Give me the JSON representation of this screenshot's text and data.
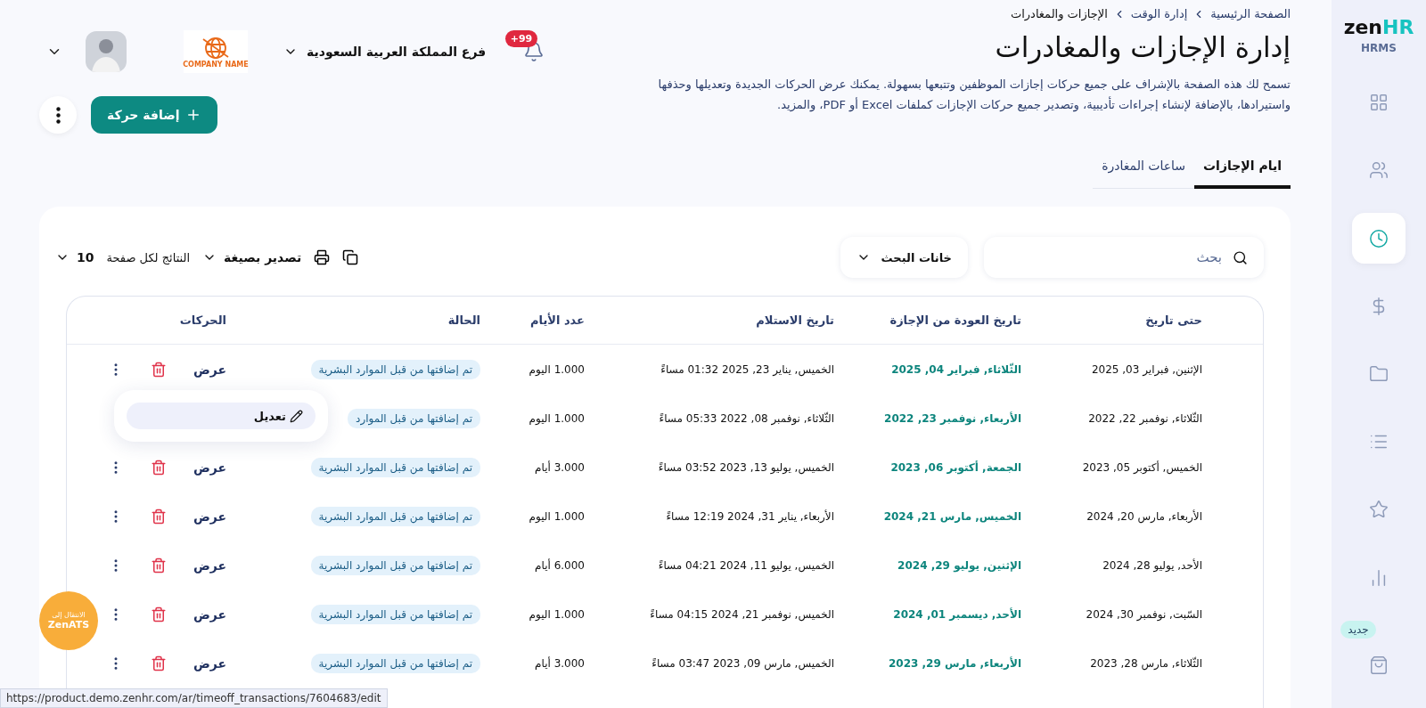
{
  "sidebar": {
    "logo_word": "zen",
    "logo_accent": "HR",
    "subtitle": "HRMS",
    "items": [
      {
        "selected": false
      },
      {
        "selected": false
      },
      {
        "selected": true
      },
      {
        "selected": false
      },
      {
        "selected": false
      },
      {
        "selected": false
      },
      {
        "selected": false
      },
      {
        "selected": false
      },
      {
        "selected": false
      }
    ],
    "new_badge": "جديد"
  },
  "breadcrumbs": [
    "الصفحة الرئيسية",
    "إدارة الوقت",
    "الإجازات والمغادرات"
  ],
  "title": "إدارة الإجازات والمغادرات",
  "description": "تسمح لك هذه الصفحة بالإشراف على جميع حركات إجازات الموظفين وتتبعها بسهولة. يمكنك عرض الحركات الجديدة وتعديلها وحذفها واستيرادها، بالإضافة لإنشاء إجراءات تأديبية، وتصدير جميع حركات الإجازات كملفات Excel أو PDF، والمزيد.",
  "topbar": {
    "notifications_badge": "+99",
    "branch": "فرع المملكة العربية السعودية",
    "company_logo_text": "COMPANY NAME"
  },
  "add_button": "إضافة حركة",
  "tabs": [
    {
      "label": "ايام الإجازات",
      "selected": true
    },
    {
      "label": "ساعات المغادرة",
      "selected": false
    }
  ],
  "search": {
    "placeholder": "بحث"
  },
  "search_fields_button": "خانات البحث",
  "export_label": "تصدير بصيغة",
  "per_page": {
    "label": "النتائج لكل صفحة",
    "value": "10"
  },
  "table": {
    "columns": [
      "حتى تاريخ",
      "تاريخ العودة من الإجازة",
      "تاريخ الاستلام",
      "عدد الأيام",
      "الحالة",
      "الحركات"
    ],
    "rows": [
      {
        "until": "الإثنين, فبراير 03, 2025",
        "return": "الثّلاثاء, فبراير 04, 2025",
        "received": "الخميس, يناير 23, 2025 01:32 مساءً",
        "days": "1.000 اليوم",
        "status": "تم إضافتها من قبل الموارد البشرية",
        "view": "عرض"
      },
      {
        "until": "الثّلاثاء, نوفمبر 22, 2022",
        "return": "الأربعاء, نوفمبر 23, 2022",
        "received": "الثّلاثاء, نوفمبر 08, 2022 05:33 مساءً",
        "days": "1.000 اليوم",
        "status": "تم إضافتها من قبل الموارد"
      },
      {
        "until": "الخميس, أكتوبر 05, 2023",
        "return": "الجمعة, أكتوبر 06, 2023",
        "received": "الخميس, يوليو 13, 2023 03:52 مساءً",
        "days": "3.000 أيام",
        "status": "تم إضافتها من قبل الموارد البشرية",
        "view": "عرض"
      },
      {
        "until": "الأربعاء, مارس 20, 2024",
        "return": "الخميس, مارس 21, 2024",
        "received": "الأربعاء, يناير 31, 2024 12:19 مساءً",
        "days": "1.000 اليوم",
        "status": "تم إضافتها من قبل الموارد البشرية",
        "view": "عرض"
      },
      {
        "until": "الأحد, يوليو 28, 2024",
        "return": "الإثنين, يوليو 29, 2024",
        "received": "الخميس, يوليو 11, 2024 04:21 مساءً",
        "days": "6.000 أيام",
        "status": "تم إضافتها من قبل الموارد البشرية",
        "view": "عرض"
      },
      {
        "until": "السّبت, نوفمبر 30, 2024",
        "return": "الأحد, ديسمبر 01, 2024",
        "received": "الخميس, نوفمبر 21, 2024 04:15 مساءً",
        "days": "1.000 اليوم",
        "status": "تم إضافتها من قبل الموارد البشرية",
        "view": "عرض"
      },
      {
        "until": "الثّلاثاء, مارس 28, 2023",
        "return": "الأربعاء, مارس 29, 2023",
        "received": "الخميس, مارس 09, 2023 03:47 مساءً",
        "days": "3.000 أيام",
        "status": "تم إضافتها من قبل الموارد البشرية",
        "view": "عرض"
      }
    ]
  },
  "row_menu": {
    "items": [
      "تعديل"
    ]
  },
  "ats_button": {
    "line_1": "الانتقال إلى",
    "line_2": "ZenATS"
  },
  "status_bar": {
    "url": "https://product.demo.zenhr.com/ar/timeoff_transactions/7604683/edit"
  }
}
